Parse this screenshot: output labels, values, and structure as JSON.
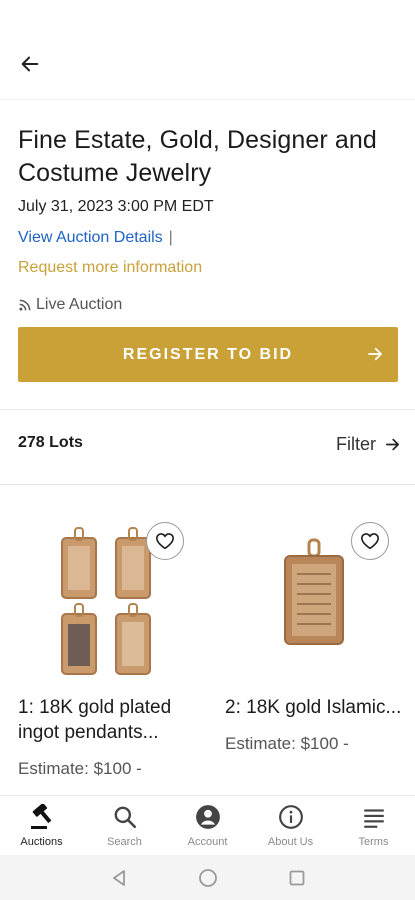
{
  "auction": {
    "title": "Fine Estate, Gold, Designer and Costume Jewelry",
    "date": "July 31, 2023 3:00 PM EDT",
    "view_details_link": "View Auction Details",
    "separator": "|",
    "request_info_link": "Request more information",
    "live_label": "Live Auction",
    "register_button": "REGISTER TO BID"
  },
  "lots": {
    "count_label": "278 Lots",
    "filter_label": "Filter",
    "items": [
      {
        "title": "1: 18K gold plated ingot pendants...",
        "estimate": "Estimate: $100 -"
      },
      {
        "title": "2: 18K gold Islamic...",
        "estimate": "Estimate: $100 -"
      }
    ]
  },
  "bottom_nav": [
    {
      "label": "Auctions",
      "icon": "gavel-icon",
      "active": true
    },
    {
      "label": "Search",
      "icon": "search-icon",
      "active": false
    },
    {
      "label": "Account",
      "icon": "account-icon",
      "active": false
    },
    {
      "label": "About Us",
      "icon": "info-icon",
      "active": false
    },
    {
      "label": "Terms",
      "icon": "terms-icon",
      "active": false
    }
  ],
  "colors": {
    "accent_gold": "#c9a137",
    "link_blue": "#1e63c6"
  }
}
